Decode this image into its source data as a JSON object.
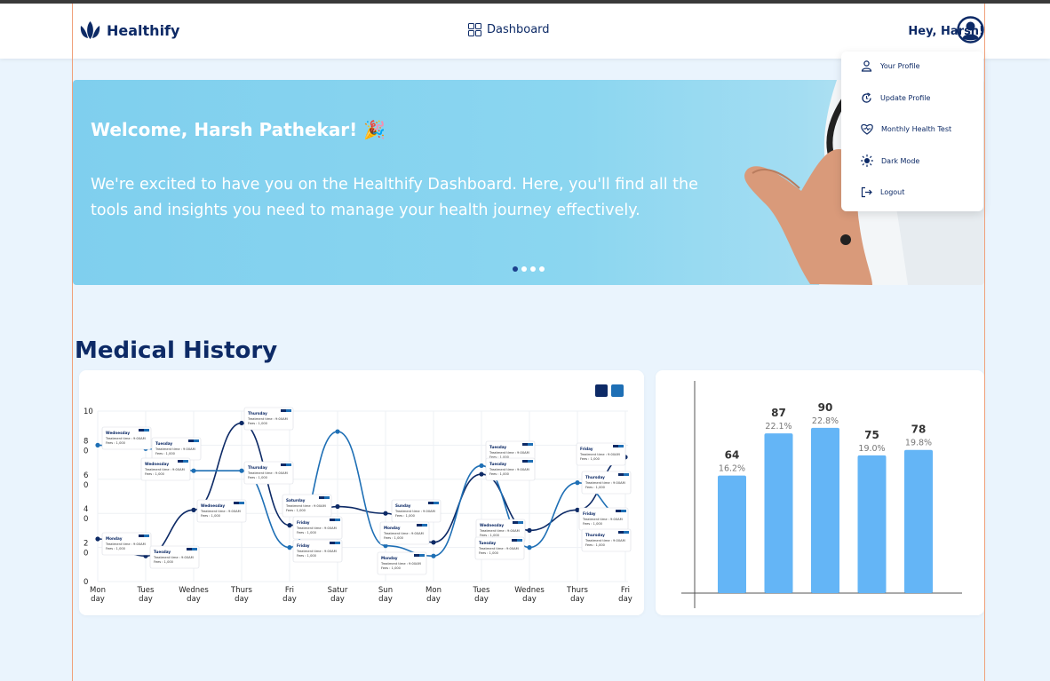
{
  "brand": {
    "name": "Healthify",
    "accent": "#0d2a66",
    "light_blue": "#64b5f6"
  },
  "nav": {
    "center_label": "Dashboard",
    "greeting": "Hey, Harsh!"
  },
  "profile_menu": {
    "items": [
      {
        "label": "Your Profile",
        "icon": "user-icon"
      },
      {
        "label": "Update Profile",
        "icon": "refresh-icon"
      },
      {
        "label": "Monthly Health Test",
        "icon": "heart-pulse-icon"
      },
      {
        "label": "Dark Mode",
        "icon": "sun-icon"
      },
      {
        "label": "Logout",
        "icon": "logout-icon"
      }
    ]
  },
  "banner": {
    "title": "Welcome, Harsh Pathekar! 🎉",
    "text": "We're excited to have you on the Healthify Dashboard. Here, you'll find all the tools and insights you need to manage your health journey effectively.",
    "slides": 4,
    "active_slide": 1
  },
  "medical_history": {
    "title": "Medical History"
  },
  "chart_data": [
    {
      "type": "line",
      "y_ticks": [
        "10",
        "8\n0",
        "6\n0",
        "4\n0",
        "2\n0",
        "0"
      ],
      "ylim": [
        0,
        10
      ],
      "categories": [
        "Mon\nday",
        "Tues\nday",
        "Wednes\nday",
        "Thurs\nday",
        "Fri\nday",
        "Satur\nday",
        "Sun\nday",
        "Mon\nday",
        "Tues\nday",
        "Wednes\nday",
        "Thurs\nday",
        "Fri\nday"
      ],
      "legend_colors": [
        "#0d2a66",
        "#1e6fb5"
      ],
      "series": [
        {
          "color": "#0d2a66",
          "values": [
            2.5,
            1.5,
            4.2,
            9.3,
            3.3,
            4.4,
            4.0,
            2.3,
            6.3,
            3.0,
            4.2,
            7.3
          ]
        },
        {
          "color": "#1e6fb5",
          "values": [
            8.0,
            7.8,
            6.5,
            6.5,
            2.0,
            8.8,
            2.1,
            1.5,
            6.8,
            2.0,
            5.8,
            3.8
          ]
        }
      ],
      "tooltips": [
        {
          "day": "Wednesday",
          "line1": "Treatment time : 9:00AM",
          "line2": "Fees : 1,000"
        },
        {
          "day": "Tuesday",
          "line1": "Treatment time : 9:00AM",
          "line2": "Fees : 1,000"
        },
        {
          "day": "Wednesday",
          "line1": "Treatment time : 9:00AM",
          "line2": "Fees : 1,000"
        },
        {
          "day": "Thursday",
          "line1": "Treatment time : 9:00AM",
          "line2": "Fees : 1,000"
        },
        {
          "day": "Thursday",
          "line1": "Treatment time : 9:00AM",
          "line2": "Fees : 1,000"
        },
        {
          "day": "Wednesday",
          "line1": "Treatment time : 9:00AM",
          "line2": "Fees : 1,000"
        },
        {
          "day": "Monday",
          "line1": "Treatment time : 9:00AM",
          "line2": "Fees : 1,000"
        },
        {
          "day": "Tuesday",
          "line1": "Treatment time : 9:00AM",
          "line2": "Fees : 1,000"
        },
        {
          "day": "Saturday",
          "line1": "Treatment time : 9:00AM",
          "line2": "Fees : 1,000"
        },
        {
          "day": "Friday",
          "line1": "Treatment time : 9:00AM",
          "line2": "Fees : 1,000"
        },
        {
          "day": "Friday",
          "line1": "Treatment time : 9:00AM",
          "line2": "Fees : 1,000"
        },
        {
          "day": "Sunday",
          "line1": "Treatment time : 9:00AM",
          "line2": "Fees : 1,000"
        },
        {
          "day": "Monday",
          "line1": "Treatment time : 9:00AM",
          "line2": "Fees : 1,000"
        },
        {
          "day": "Monday",
          "line1": "Treatment time : 9:00AM",
          "line2": "Fees : 1,000"
        },
        {
          "day": "Tuesday",
          "line1": "Treatment time : 9:00AM",
          "line2": "Fees : 1,000"
        },
        {
          "day": "Tuesday",
          "line1": "Treatment time : 9:00AM",
          "line2": "Fees : 1,000"
        },
        {
          "day": "Wednesday",
          "line1": "Treatment time : 9:00AM",
          "line2": "Fees : 1,000"
        },
        {
          "day": "Tuesday",
          "line1": "Treatment time : 9:00AM",
          "line2": "Fees : 1,000"
        },
        {
          "day": "Friday",
          "line1": "Treatment time : 9:00AM",
          "line2": "Fees : 1,000"
        },
        {
          "day": "Thursday",
          "line1": "Treatment time : 9:00AM",
          "line2": "Fees : 1,000"
        },
        {
          "day": "Friday",
          "line1": "Treatment time : 9:00AM",
          "line2": "Fees : 1,000"
        },
        {
          "day": "Thursday",
          "line1": "Treatment time : 9:00AM",
          "line2": "Fees : 1,000"
        }
      ]
    },
    {
      "type": "bar",
      "values": [
        64,
        87,
        90,
        75,
        78
      ],
      "percent_labels": [
        "16.2%",
        "22.1%",
        "22.8%",
        "19.0%",
        "19.8%"
      ],
      "color": "#64b5f6",
      "ylim": [
        0,
        100
      ]
    }
  ]
}
